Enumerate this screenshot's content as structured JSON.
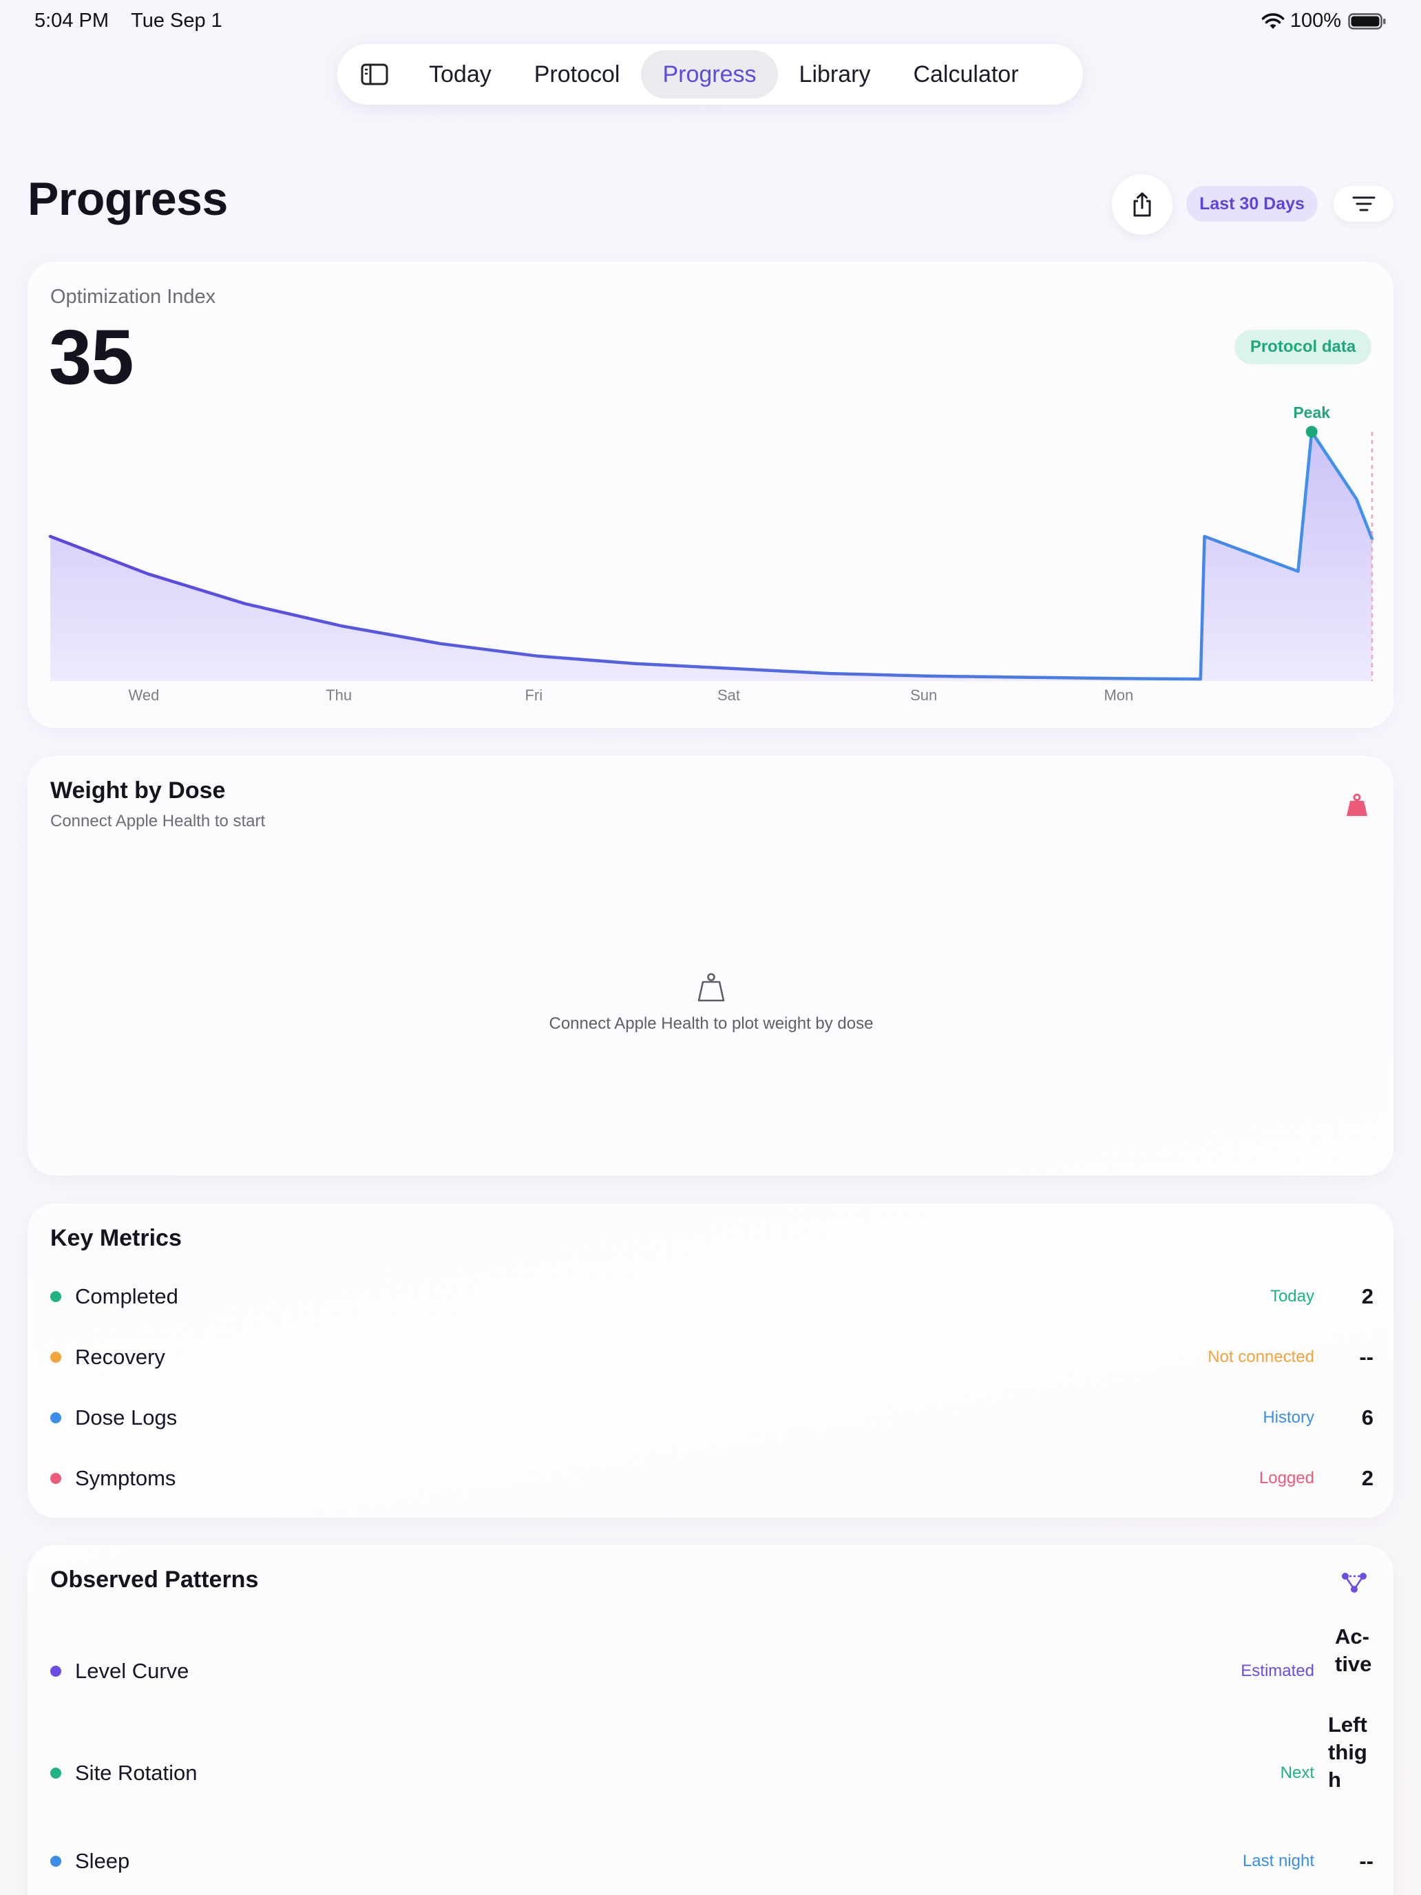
{
  "status": {
    "time": "5:04 PM",
    "date": "Tue Sep 1",
    "battery": "100%"
  },
  "nav": {
    "tabs": [
      {
        "label": "Today"
      },
      {
        "label": "Protocol"
      },
      {
        "label": "Progress"
      },
      {
        "label": "Library"
      },
      {
        "label": "Calculator"
      }
    ],
    "active": "Progress"
  },
  "page": {
    "title": "Progress"
  },
  "toolbar": {
    "range": "Last 30 Days"
  },
  "optimization": {
    "label": "Optimization Index",
    "value": "35",
    "badge": "Protocol data",
    "peak_label": "Peak",
    "chart_data": {
      "type": "area",
      "x_ticks": [
        "Wed",
        "Thu",
        "Fri",
        "Sat",
        "Sun",
        "Mon"
      ],
      "series": [
        {
          "values": [
            [
              0.0,
              58
            ],
            [
              0.5,
              43
            ],
            [
              1.0,
              31
            ],
            [
              1.5,
              22
            ],
            [
              2.0,
              15
            ],
            [
              2.5,
              10
            ],
            [
              3.0,
              7
            ],
            [
              3.5,
              5
            ],
            [
              4.0,
              3
            ],
            [
              4.5,
              2
            ],
            [
              5.0,
              1.5
            ],
            [
              5.5,
              1
            ],
            [
              5.9,
              0.8
            ],
            [
              5.92,
              58
            ],
            [
              6.4,
              44
            ],
            [
              6.47,
              100
            ],
            [
              6.7,
              73
            ],
            [
              6.78,
              57
            ]
          ]
        }
      ],
      "peak": {
        "x": 6.47,
        "y": 100
      },
      "ylim": [
        0,
        100
      ],
      "colors": {
        "line": "#4f63e6",
        "fill": "#c6bdf6",
        "peak": "#1fa77c",
        "now_marker": "#f0a3bd"
      }
    }
  },
  "weight": {
    "title": "Weight by Dose",
    "subtitle": "Connect Apple Health to start",
    "empty_text": "Connect Apple Health to plot weight by dose",
    "icon": "weight-icon",
    "icon_color": "#ee5a7a"
  },
  "metrics": {
    "title": "Key Metrics",
    "rows": [
      {
        "label": "Completed",
        "tag": "Today",
        "value": "2",
        "color": "#1fb383"
      },
      {
        "label": "Recovery",
        "tag": "Not connected",
        "value": "--",
        "color": "#f2a33a"
      },
      {
        "label": "Dose Logs",
        "tag": "History",
        "value": "6",
        "color": "#3a8ee9"
      },
      {
        "label": "Symptoms",
        "tag": "Logged",
        "value": "2",
        "color": "#ee5a7a"
      }
    ]
  },
  "patterns": {
    "title": "Observed Patterns",
    "icon": "pattern-nodes-icon",
    "rows": [
      {
        "label": "Level Curve",
        "tag": "Estimated",
        "value_lines": [
          "Ac-",
          "tive"
        ],
        "color": "#6d4ce6"
      },
      {
        "label": "Site Rotation",
        "tag": "Next",
        "value_lines": [
          "Left",
          "thig",
          "h"
        ],
        "color": "#1fb383"
      },
      {
        "label": "Sleep",
        "tag": "Last night",
        "value_lines": [
          "--"
        ],
        "color": "#3a8ee9"
      }
    ]
  }
}
